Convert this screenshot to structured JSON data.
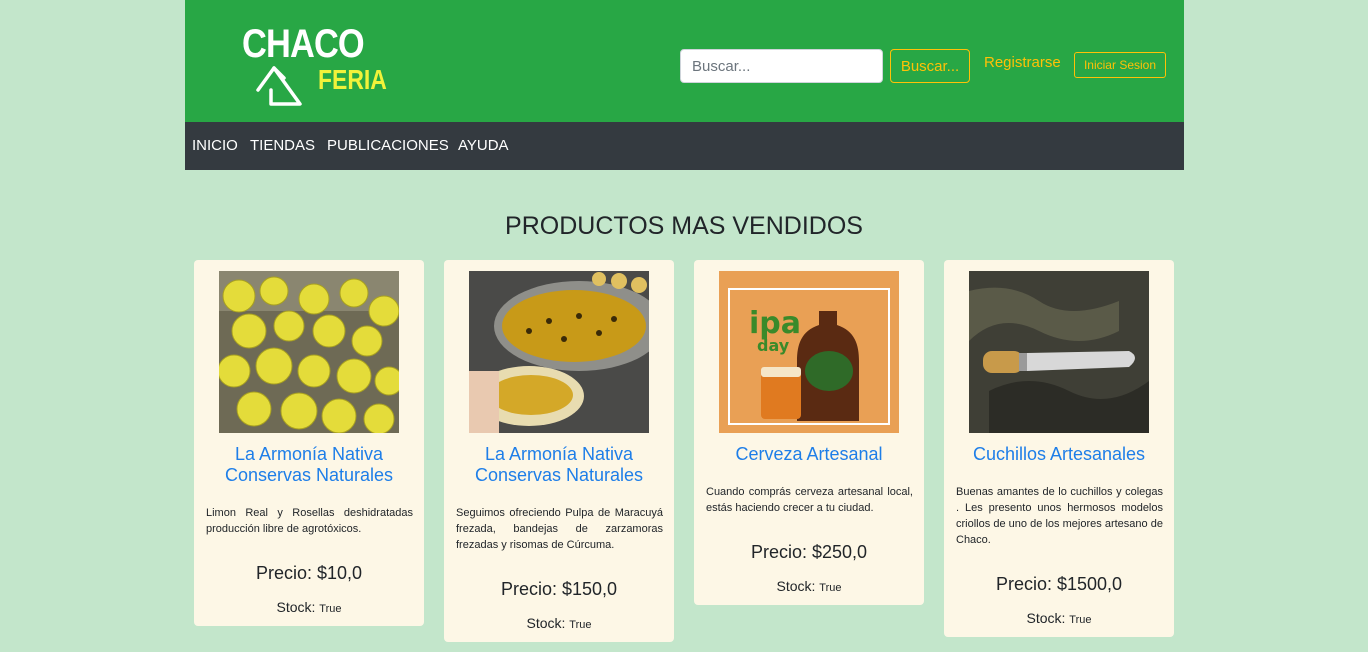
{
  "header": {
    "logo_top": "CHACO",
    "logo_bottom": "FERIA",
    "search_placeholder": "Buscar...",
    "search_button": "Buscar...",
    "register_link": "Registrarse",
    "login_button": "Iniciar Sesion"
  },
  "nav": {
    "items": [
      {
        "label": "INICIO"
      },
      {
        "label": "TIENDAS"
      },
      {
        "label": "PUBLICACIONES"
      },
      {
        "label": "AYUDA"
      }
    ]
  },
  "main": {
    "section_title": "PRODUCTOS MAS VENDIDOS",
    "stock_label": "Stock:",
    "products": [
      {
        "image": "lemons-photo",
        "title": "La Armonía Nativa Conservas Naturales",
        "description": "Limon Real y Rosellas deshidratadas producción libre de agrotóxicos.",
        "price": "Precio: $10,0",
        "stock": "True"
      },
      {
        "image": "passion-fruit-photo",
        "title": "La Armonía Nativa Conservas Naturales",
        "description": "Seguimos ofreciendo Pulpa de Maracuyá frezada, bandejas de zarzamoras frezadas y risomas de Cúrcuma.",
        "price": "Precio: $150,0",
        "stock": "True"
      },
      {
        "image": "beer-photo",
        "title": "Cerveza Artesanal",
        "description": "Cuando comprás cerveza artesanal local, estás haciendo crecer a tu ciudad.",
        "price": "Precio: $250,0",
        "stock": "True"
      },
      {
        "image": "knife-photo",
        "title": "Cuchillos Artesanales",
        "description": "Buenas amantes de lo cuchillos y colegas . Les presento unos hermosos modelos criollos de uno de los mejores artesano de Chaco.",
        "price": "Precio: $1500,0",
        "stock": "True"
      }
    ]
  },
  "colors": {
    "header_bg": "#28a745",
    "navbar_bg": "#343a40",
    "page_bg": "#c3e6cb",
    "card_bg": "#fdf7e6",
    "accent_yellow": "#ffc107",
    "link_blue": "#1e7ee8"
  }
}
